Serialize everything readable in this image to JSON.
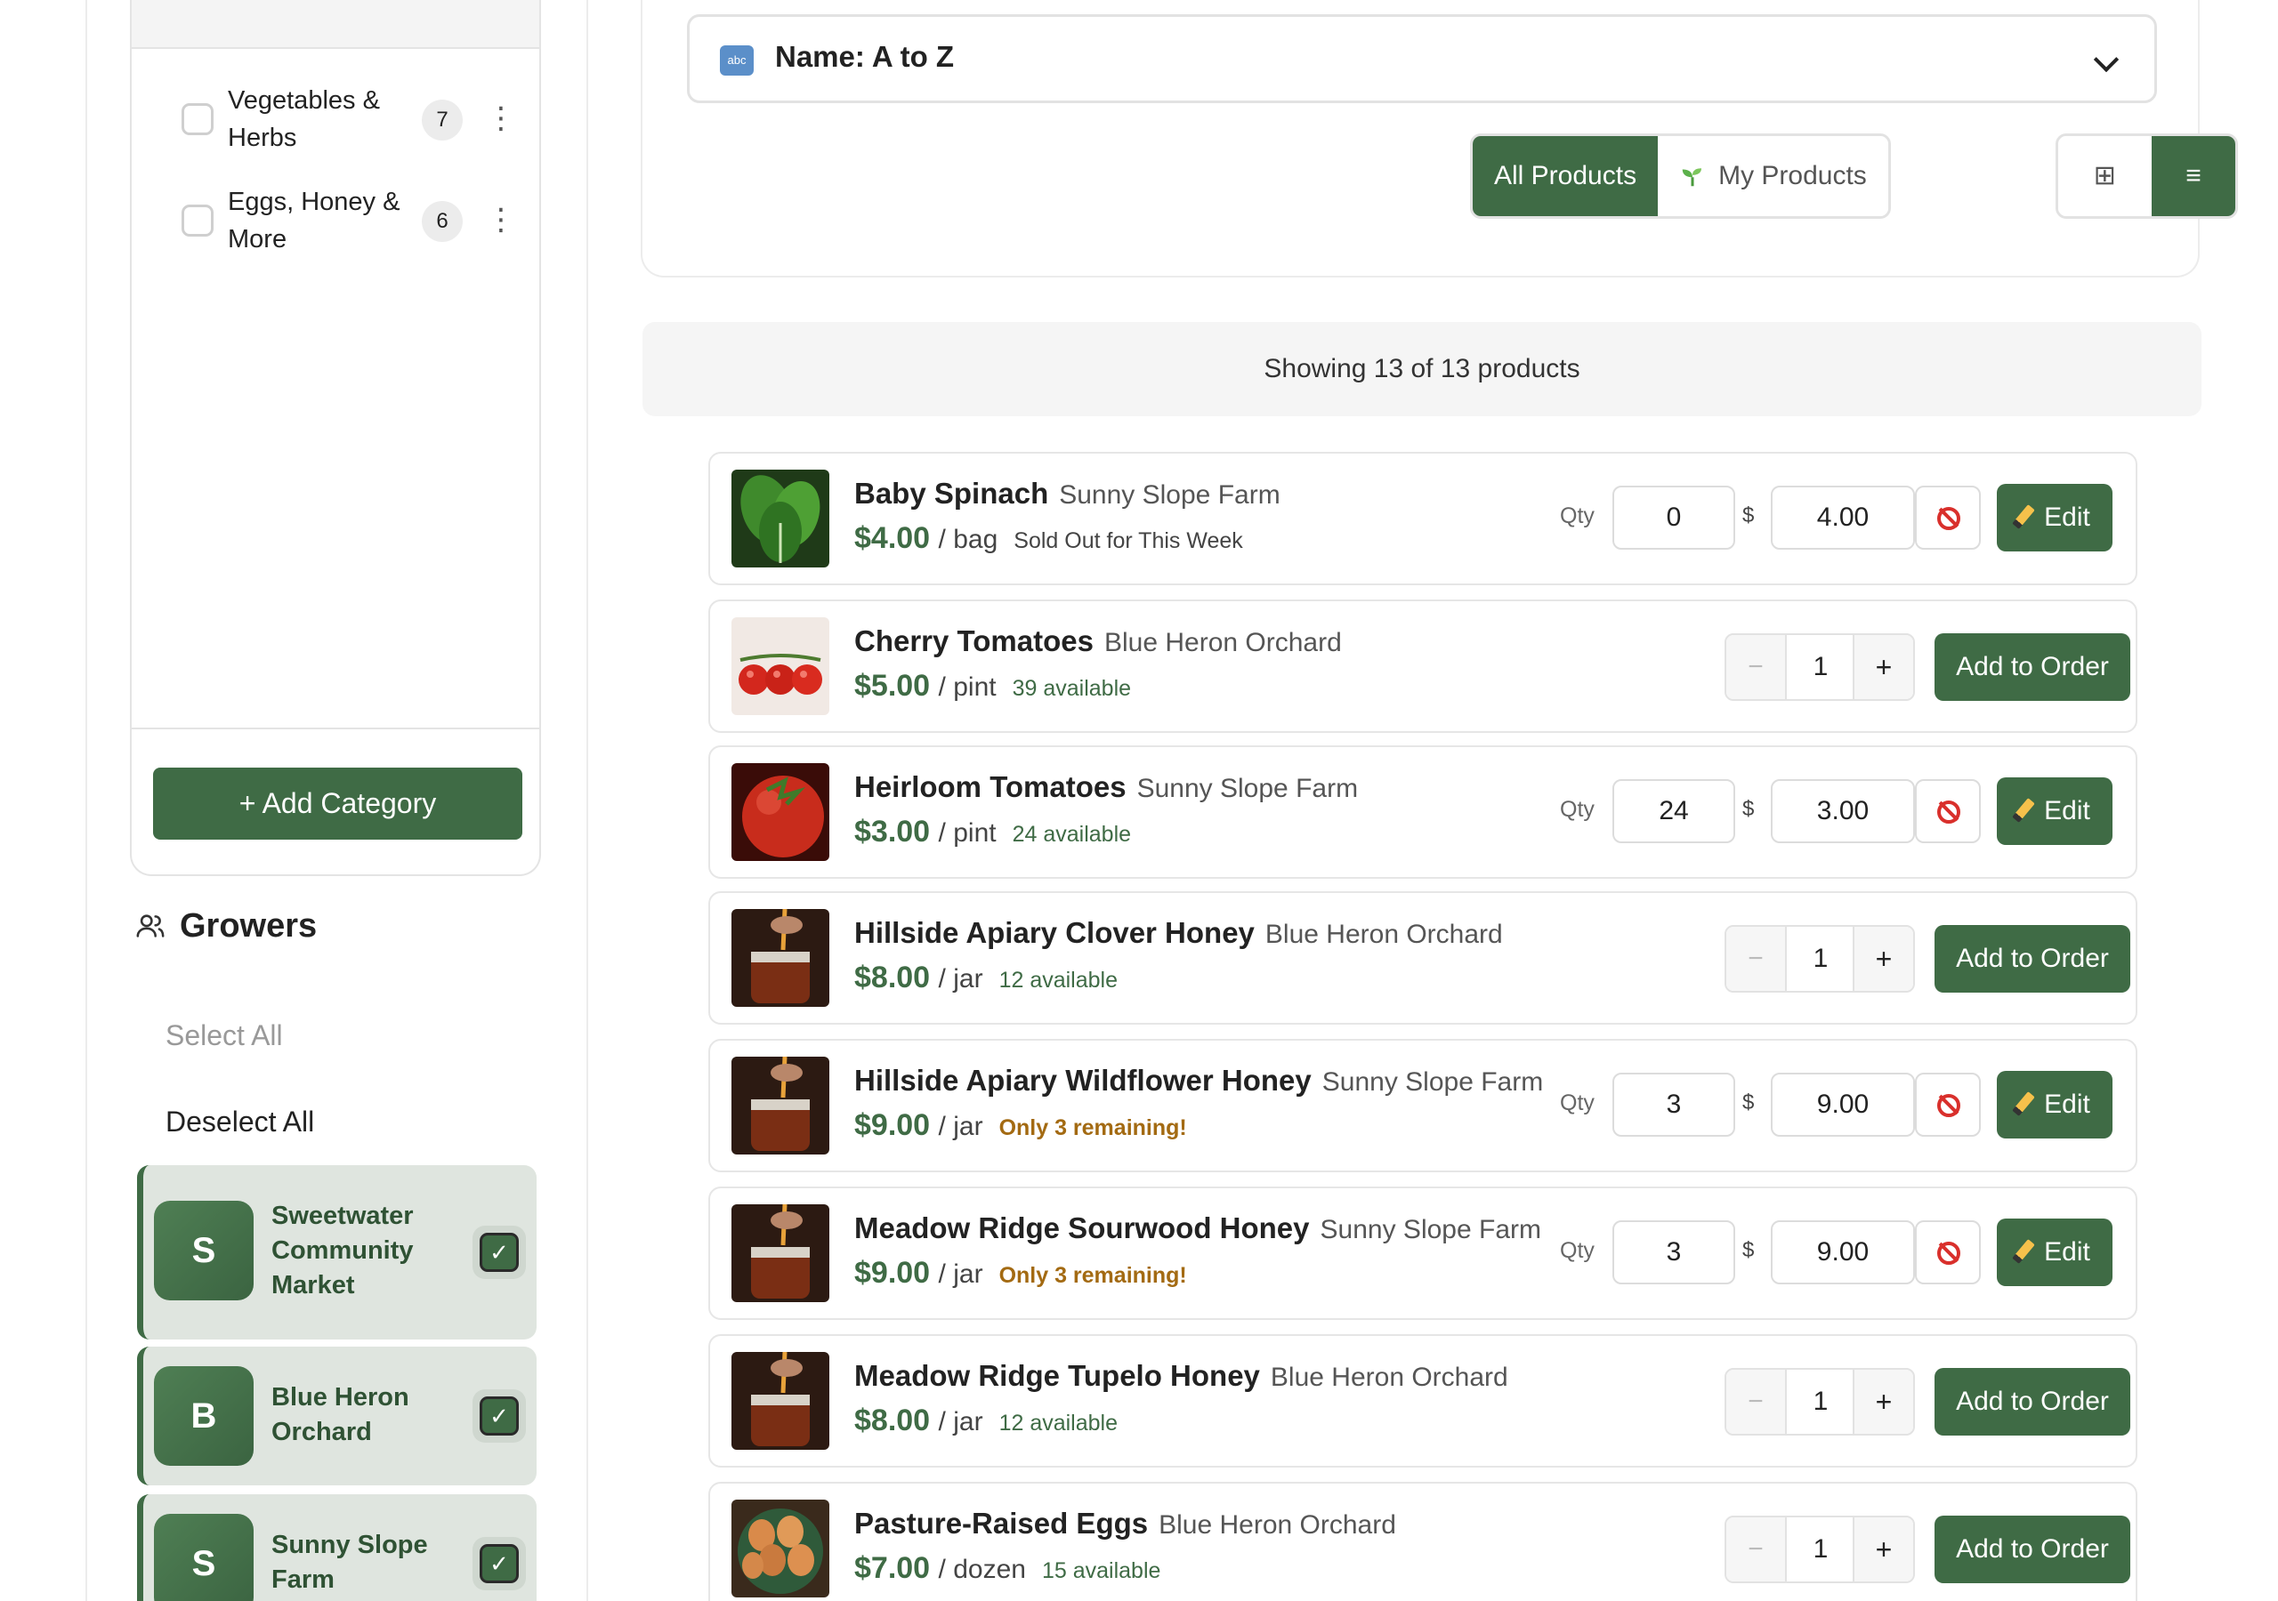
{
  "categories": [
    {
      "label": "Vegetables & Herbs",
      "count": "7"
    },
    {
      "label": "Eggs, Honey & More",
      "count": "6"
    }
  ],
  "category_actions": {
    "menu_glyph": "⋮",
    "add_label": "+ Add Category"
  },
  "growers": {
    "title": "Growers",
    "select_all": "Select All",
    "deselect_all": "Deselect All",
    "check_glyph": "✓",
    "items": [
      {
        "initial": "S",
        "name": "Sweetwater Community Market",
        "checked": true
      },
      {
        "initial": "B",
        "name": "Blue Heron Orchard",
        "checked": true
      },
      {
        "initial": "S",
        "name": "Sunny Slope Farm",
        "checked": true
      }
    ]
  },
  "sort": {
    "icon_text": "abc",
    "label": "Name: A to Z"
  },
  "filters": {
    "all": "All Products",
    "mine": "My Products",
    "mine_icon": "seedling-icon"
  },
  "views": {
    "grid": "⊞ Grid",
    "list": "≡ List",
    "active": "list"
  },
  "showing_text": "Showing 13 of 13 products",
  "labels": {
    "qty": "Qty",
    "dollar": "$",
    "edit": "Edit",
    "add_to_order": "Add to Order",
    "minus": "−",
    "plus": "+"
  },
  "products": [
    {
      "name": "Baby Spinach",
      "farm": "Sunny Slope Farm",
      "price": "$4.00",
      "unit": "/ bag",
      "availability": "Sold Out for This Week",
      "mode": "edit",
      "qty": "0",
      "set_price": "4.00",
      "image": "spinach"
    },
    {
      "name": "Cherry Tomatoes",
      "farm": "Blue Heron Orchard",
      "price": "$5.00",
      "unit": "/ pint",
      "availability": "39 available",
      "mode": "order",
      "order_qty": "1",
      "image": "cherry-tomatoes"
    },
    {
      "name": "Heirloom Tomatoes",
      "farm": "Sunny Slope Farm",
      "price": "$3.00",
      "unit": "/ pint",
      "availability": "24 available",
      "mode": "edit",
      "qty": "24",
      "set_price": "3.00",
      "image": "tomatoes"
    },
    {
      "name": "Hillside Apiary Clover Honey",
      "farm": "Blue Heron Orchard",
      "price": "$8.00",
      "unit": "/ jar",
      "availability": "12 available",
      "mode": "order",
      "order_qty": "1",
      "image": "honey"
    },
    {
      "name": "Hillside Apiary Wildflower Honey",
      "farm": "Sunny Slope Farm",
      "price": "$9.00",
      "unit": "/ jar",
      "availability": "Only 3 remaining!",
      "mode": "edit",
      "qty": "3",
      "set_price": "9.00",
      "image": "honey"
    },
    {
      "name": "Meadow Ridge Sourwood Honey",
      "farm": "Sunny Slope Farm",
      "price": "$9.00",
      "unit": "/ jar",
      "availability": "Only 3 remaining!",
      "mode": "edit",
      "qty": "3",
      "set_price": "9.00",
      "image": "honey"
    },
    {
      "name": "Meadow Ridge Tupelo Honey",
      "farm": "Blue Heron Orchard",
      "price": "$8.00",
      "unit": "/ jar",
      "availability": "12 available",
      "mode": "order",
      "order_qty": "1",
      "image": "honey"
    },
    {
      "name": "Pasture-Raised Eggs",
      "farm": "Blue Heron Orchard",
      "price": "$7.00",
      "unit": "/ dozen",
      "availability": "15 available",
      "mode": "order",
      "order_qty": "1",
      "image": "eggs"
    }
  ],
  "colors": {
    "accent": "#3f6b45",
    "warning": "#a36a12",
    "danger": "#d9302c"
  }
}
